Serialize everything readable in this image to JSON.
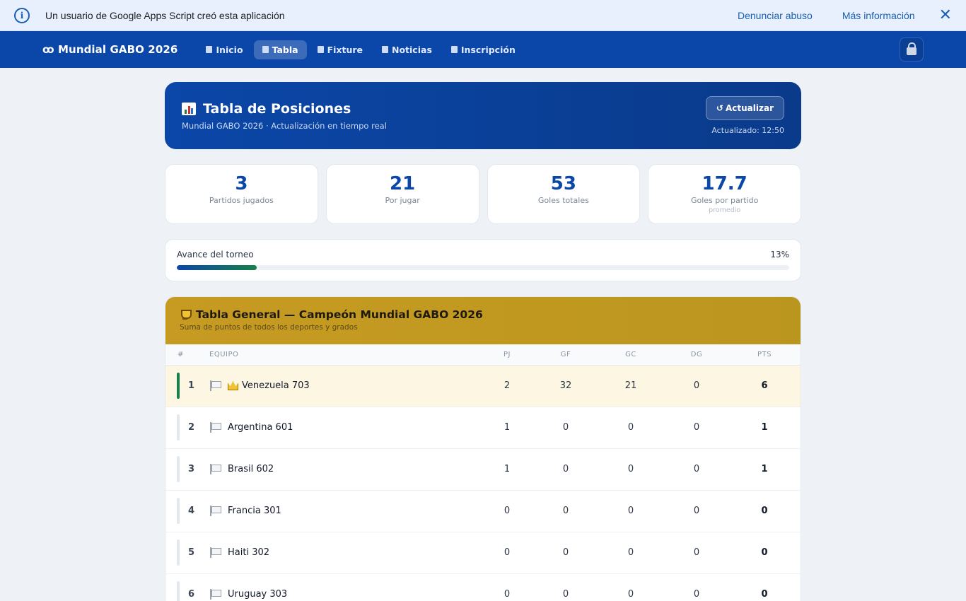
{
  "banner": {
    "text": "Un usuario de Google Apps Script creó esta aplicación",
    "report_link": "Denunciar abuso",
    "more_info_link": "Más información"
  },
  "nav": {
    "brand": "ꝏ Mundial GABO 2026",
    "items": [
      {
        "label": "Inicio",
        "icon": "home-icon"
      },
      {
        "label": "Tabla",
        "icon": "chart-icon",
        "active": true
      },
      {
        "label": "Fixture",
        "icon": "document-icon"
      },
      {
        "label": "Noticias",
        "icon": "newspaper-icon"
      },
      {
        "label": "Inscripción",
        "icon": "form-icon"
      }
    ]
  },
  "hero": {
    "title": "Tabla de Posiciones",
    "subtitle": "Mundial GABO 2026 · Actualización en tiempo real",
    "refresh_label": "Actualizar",
    "updated": "Actualizado: 12:50"
  },
  "stats": [
    {
      "value": "3",
      "label": "Partidos jugados"
    },
    {
      "value": "21",
      "label": "Por jugar"
    },
    {
      "value": "53",
      "label": "Goles totales"
    },
    {
      "value": "17.7",
      "label": "Goles por partido",
      "extra": "promedio"
    }
  ],
  "progress": {
    "label": "Avance del torneo",
    "percent_label": "13%",
    "percent": 13
  },
  "table": {
    "title": "Tabla General — Campeón Mundial GABO 2026",
    "subtitle": "Suma de puntos de todos los deportes y grados",
    "headers": [
      "#",
      "EQUIPO",
      "PJ",
      "GF",
      "GC",
      "DG",
      "PTS"
    ],
    "rows": [
      {
        "rank": "1",
        "team": "Venezuela 703",
        "pj": "2",
        "gf": "32",
        "gc": "21",
        "dg": "0",
        "pts": "6",
        "leader": true
      },
      {
        "rank": "2",
        "team": "Argentina 601",
        "pj": "1",
        "gf": "0",
        "gc": "0",
        "dg": "0",
        "pts": "1"
      },
      {
        "rank": "3",
        "team": "Brasil 602",
        "pj": "1",
        "gf": "0",
        "gc": "0",
        "dg": "0",
        "pts": "1"
      },
      {
        "rank": "4",
        "team": "Francia 301",
        "pj": "0",
        "gf": "0",
        "gc": "0",
        "dg": "0",
        "pts": "0"
      },
      {
        "rank": "5",
        "team": "Haiti 302",
        "pj": "0",
        "gf": "0",
        "gc": "0",
        "dg": "0",
        "pts": "0"
      },
      {
        "rank": "6",
        "team": "Uruguay 303",
        "pj": "0",
        "gf": "0",
        "gc": "0",
        "dg": "0",
        "pts": "0"
      }
    ]
  },
  "colors": {
    "primary": "#0b47a8",
    "gold": "#c79b22",
    "leader_bar": "#17804a",
    "leader_row": "#fdf6e3"
  }
}
